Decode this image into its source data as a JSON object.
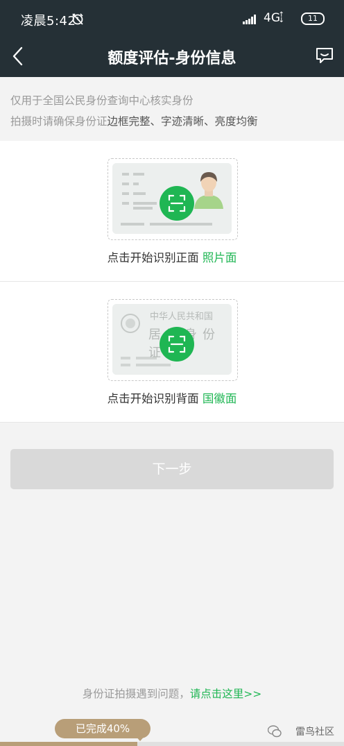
{
  "status": {
    "time": "凌晨5:42",
    "network": "4G",
    "battery": "11"
  },
  "header": {
    "title": "额度评估-身份信息"
  },
  "notice": {
    "line1": "仅用于全国公民身份查询中心核实身份",
    "line2_prefix": "拍摄时请确保身份证",
    "line2_emphasis": "边框完整、字迹清晰、亮度均衡"
  },
  "front": {
    "caption": "点击开始识别正面",
    "highlight": "照片面"
  },
  "back": {
    "caption": "点击开始识别背面",
    "highlight": "国徽面",
    "card_title": "中华人民共和国",
    "card_subtitle": "居民身份证"
  },
  "next_button": {
    "label": "下一步"
  },
  "help": {
    "text": "身份证拍摄遇到问题，",
    "link": "请点击这里>>"
  },
  "progress": {
    "label": "已完成40%",
    "value": 0.4
  },
  "watermark": {
    "text": "雷鸟社区"
  },
  "colors": {
    "header_bg": "#253036",
    "accent_green": "#1fb653",
    "progress_gold": "#b89e78"
  },
  "icons": {
    "back": "back-arrow-icon",
    "feedback": "chat-icon",
    "scan": "scan-icon",
    "alarm": "alarm-off-icon"
  }
}
